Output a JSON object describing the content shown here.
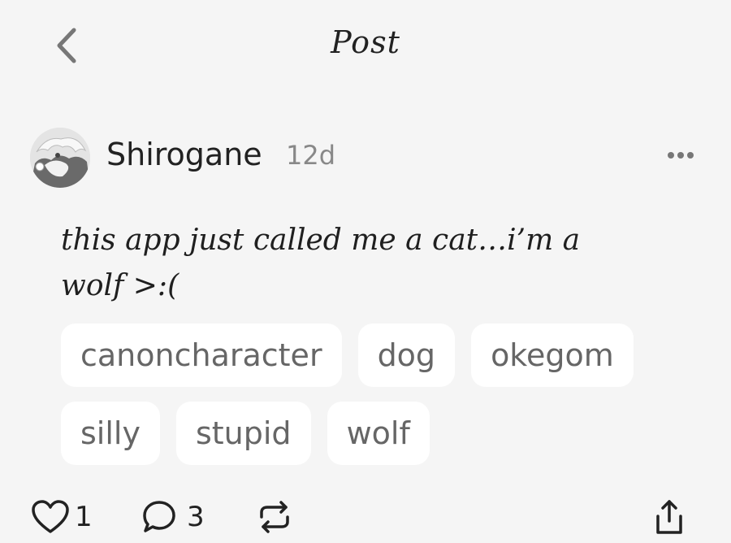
{
  "header": {
    "title": "Post",
    "back_icon": "chevron-left-icon"
  },
  "post": {
    "author": "Shirogane",
    "timestamp": "12d",
    "more_icon": "more-horizontal-icon",
    "body_line1": "this app just called me a cat…i’m a",
    "body_line2": "wolf >:(",
    "tags": [
      "canoncharacter",
      "dog",
      "okegom",
      "silly",
      "stupid",
      "wolf"
    ]
  },
  "actions": {
    "likes": "1",
    "comments": "3",
    "like_icon": "heart-icon",
    "comment_icon": "comment-icon",
    "repost_icon": "repost-icon",
    "share_icon": "share-icon"
  }
}
